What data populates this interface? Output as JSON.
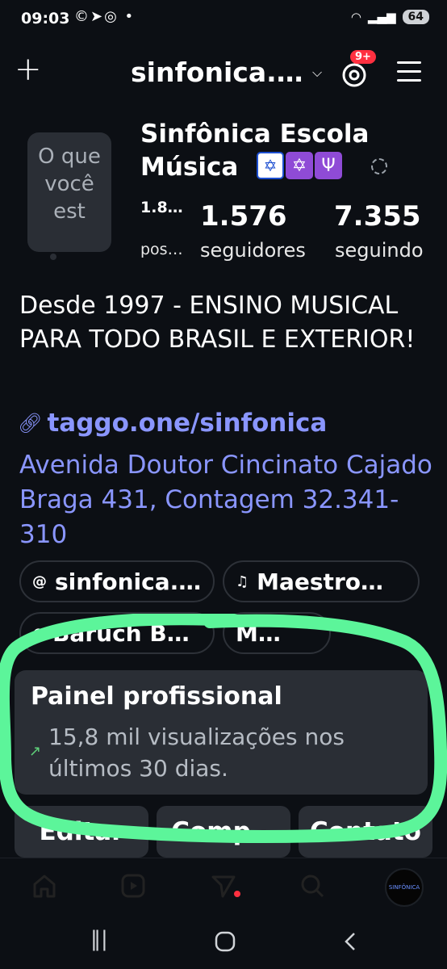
{
  "status_bar": {
    "time": "09:03",
    "left_icons": "©➤◎ •",
    "battery": "64"
  },
  "header": {
    "username": "sinfonica.…",
    "notification_badge": "9+"
  },
  "profile": {
    "avatar_note": "O que você est",
    "display_name": "Sinfônica Escola Música",
    "stats": {
      "posts_value": "1.8…",
      "posts_label": "pos…",
      "followers_value": "1.576",
      "followers_label": "seguidores",
      "following_value": "7.355",
      "following_label": "seguindo"
    },
    "bio": "Desde 1997 - ENSINO MUSICAL PARA TODO BRASIL E EXTERIOR!",
    "link": "taggo.one/sinfonica",
    "address": "Avenida Doutor Cincinato Cajado Braga 431, Contagem 32.341-310"
  },
  "pills": [
    {
      "label": "sinfonica.…",
      "icon": "threads-icon"
    },
    {
      "label": "Maestro…",
      "icon": "music-icon"
    },
    {
      "label": "Baruch B…",
      "icon": "globe-icon"
    },
    {
      "label": "M…",
      "icon": ""
    }
  ],
  "dashboard": {
    "title": "Painel profissional",
    "subtitle": "15,8 mil visualizações nos últimos 30 dias."
  },
  "actions": {
    "edit": "Editar",
    "share": "Comp…",
    "contact": "Contato"
  },
  "nav": {
    "profile_avatar_text": "SINFÔNICA"
  },
  "colors": {
    "background": "#0c0f14",
    "link": "#8a96ff",
    "card": "#2a2e35",
    "badge": "#ff3040",
    "highlight": "#5cf59a"
  }
}
